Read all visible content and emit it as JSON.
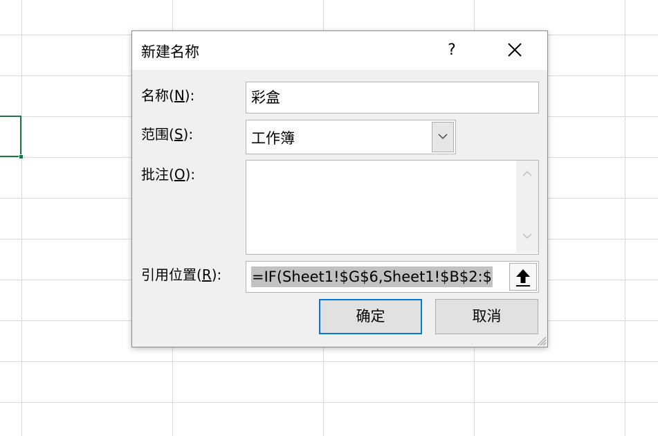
{
  "dialog": {
    "title": "新建名称",
    "help_label": "?",
    "name_label": {
      "pre": "名称(",
      "key": "N",
      "post": "):"
    },
    "name_value": "彩盒",
    "scope_label": {
      "pre": "范围(",
      "key": "S",
      "post": "):"
    },
    "scope_value": "工作簿",
    "comment_label": {
      "pre": "批注(",
      "key": "O",
      "post": "):"
    },
    "comment_value": "",
    "ref_label": {
      "pre": "引用位置(",
      "key": "R",
      "post": "):"
    },
    "ref_value": "=IF(Sheet1!$G$6,Sheet1!$B$2:$",
    "ok_label": "确定",
    "cancel_label": "取消"
  },
  "colors": {
    "accent_border": "#0078d7",
    "active_cell": "#217346",
    "dialog_bg": "#f0f0f0"
  },
  "icons": [
    "close-icon",
    "chevron-down-icon",
    "scroll-up-icon",
    "scroll-down-icon",
    "collapse-dialog-arrow-icon",
    "size-grip-icon"
  ]
}
